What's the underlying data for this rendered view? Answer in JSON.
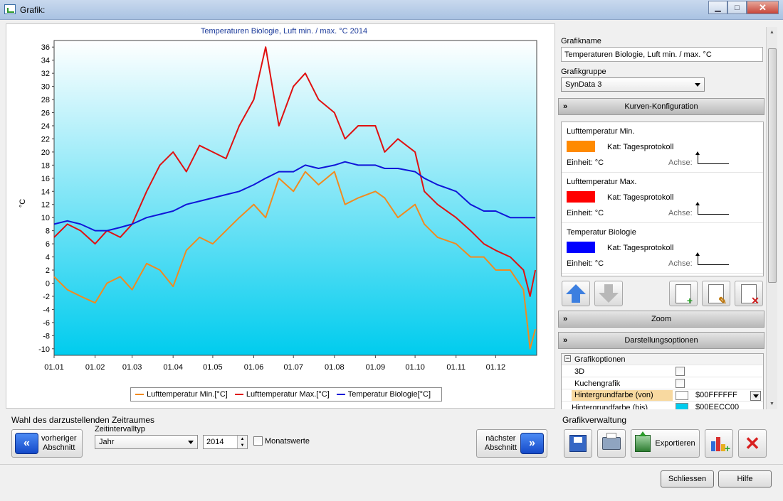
{
  "window": {
    "title": "Grafik:"
  },
  "chart_data": {
    "type": "line",
    "title": "Temperaturen Biologie, Luft min. / max. °C 2014",
    "ylabel": "°C",
    "xlabel": "",
    "ylim": [
      -11,
      37
    ],
    "xlim": [
      0,
      365
    ],
    "yticks": [
      36,
      34,
      32,
      30,
      28,
      26,
      24,
      22,
      20,
      18,
      16,
      14,
      12,
      10,
      8,
      6,
      4,
      2,
      0,
      -2,
      -4,
      -6,
      -8,
      -10
    ],
    "x_ticks": [
      {
        "label": "01.01",
        "day": 0
      },
      {
        "label": "01.02",
        "day": 31
      },
      {
        "label": "01.03",
        "day": 59
      },
      {
        "label": "01.04",
        "day": 90
      },
      {
        "label": "01.05",
        "day": 120
      },
      {
        "label": "01.06",
        "day": 151
      },
      {
        "label": "01.07",
        "day": 181
      },
      {
        "label": "01.08",
        "day": 212
      },
      {
        "label": "01.09",
        "day": 243
      },
      {
        "label": "01.10",
        "day": 273
      },
      {
        "label": "01.11",
        "day": 304
      },
      {
        "label": "01.12",
        "day": 334
      }
    ],
    "grid": false,
    "legend_position": "bottom",
    "series": [
      {
        "name": "Lufttemperatur Min.[°C]",
        "color": "#f28a1e",
        "x": [
          0,
          10,
          20,
          31,
          40,
          50,
          59,
          70,
          80,
          90,
          100,
          110,
          120,
          130,
          140,
          151,
          160,
          170,
          181,
          190,
          200,
          212,
          220,
          230,
          243,
          250,
          260,
          273,
          280,
          290,
          304,
          315,
          325,
          334,
          345,
          355,
          360,
          364
        ],
        "y": [
          1,
          -1,
          -2,
          -3,
          0,
          1,
          -1,
          3,
          2,
          -0.5,
          5,
          7,
          6,
          8,
          10,
          12,
          10,
          16,
          14,
          17,
          15,
          17,
          12,
          13,
          14,
          13,
          10,
          12,
          9,
          7,
          6,
          4,
          4,
          2,
          2,
          -1,
          -10,
          -7
        ]
      },
      {
        "name": "Lufttemperatur Max.[°C]",
        "color": "#e01010",
        "x": [
          0,
          10,
          20,
          31,
          40,
          50,
          59,
          70,
          80,
          90,
          100,
          110,
          120,
          130,
          140,
          151,
          160,
          170,
          181,
          190,
          200,
          212,
          220,
          230,
          243,
          250,
          260,
          273,
          280,
          290,
          304,
          315,
          325,
          334,
          345,
          355,
          360,
          364
        ],
        "y": [
          7,
          9,
          8,
          6,
          8,
          7,
          9,
          14,
          18,
          20,
          17,
          21,
          20,
          19,
          24,
          28,
          36,
          24,
          30,
          32,
          28,
          26,
          22,
          24,
          24,
          20,
          22,
          20,
          14,
          12,
          10,
          8,
          6,
          5,
          4,
          2,
          -2,
          2
        ]
      },
      {
        "name": "Temperatur Biologie[°C]",
        "color": "#1016d8",
        "x": [
          0,
          10,
          20,
          31,
          40,
          50,
          59,
          70,
          80,
          90,
          100,
          110,
          120,
          130,
          140,
          151,
          160,
          170,
          181,
          190,
          200,
          212,
          220,
          230,
          243,
          250,
          260,
          273,
          280,
          290,
          304,
          315,
          325,
          334,
          345,
          355,
          360,
          364
        ],
        "y": [
          9,
          9.5,
          9,
          8,
          8,
          8.5,
          9,
          10,
          10.5,
          11,
          12,
          12.5,
          13,
          13.5,
          14,
          15,
          16,
          17,
          17,
          18,
          17.5,
          18,
          18.5,
          18,
          18,
          17.5,
          17.5,
          17,
          16,
          15,
          14,
          12,
          11,
          11,
          10,
          10,
          10,
          10
        ]
      }
    ]
  },
  "controls": {
    "zeitraum_label": "Wahl des darzustellenden Zeitraumes",
    "prev_label_1": "vorheriger",
    "prev_label_2": "Abschnitt",
    "next_label_1": "nächster",
    "next_label_2": "Abschnitt",
    "intervall_label": "Zeitintervalltyp",
    "intervall_value": "Jahr",
    "year_value": "2014",
    "monatswerte_label": "Monatswerte"
  },
  "settings": {
    "grafikname_label": "Grafikname",
    "grafikname_value": "Temperaturen Biologie, Luft min. / max. °C",
    "grafikgruppe_label": "Grafikgruppe",
    "grafikgruppe_value": "SynData 3",
    "kurven_header": "Kurven-Konfiguration",
    "zoom_header": "Zoom",
    "darstellung_header": "Darstellungsoptionen",
    "curves": [
      {
        "name": "Lufttemperatur Min.",
        "color": "#ff8a00",
        "kat": "Kat: Tagesprotokoll",
        "unit": "Einheit: °C",
        "axis": "Achse:"
      },
      {
        "name": "Lufttemperatur Max.",
        "color": "#ff0000",
        "kat": "Kat: Tagesprotokoll",
        "unit": "Einheit: °C",
        "axis": "Achse:"
      },
      {
        "name": "Temperatur Biologie",
        "color": "#0000ff",
        "kat": "Kat: Tagesprotokoll",
        "unit": "Einheit: °C",
        "axis": "Achse:"
      }
    ],
    "props": {
      "group": "Grafikoptionen",
      "rows": [
        {
          "key": "3D",
          "value": ""
        },
        {
          "key": "Kuchengrafik",
          "value": ""
        },
        {
          "key": "Hintergrundfarbe (von)",
          "value": "$00FFFFFF",
          "swatch": "#ffffff"
        },
        {
          "key": "Hintergrundfarbe (bis)",
          "value": "$00EECC00",
          "swatch": "#00ccee"
        }
      ]
    }
  },
  "verwaltung": {
    "label": "Grafikverwaltung",
    "export_label": "Exportieren"
  },
  "dialog": {
    "close_label": "Schliessen",
    "help_label": "Hilfe"
  }
}
